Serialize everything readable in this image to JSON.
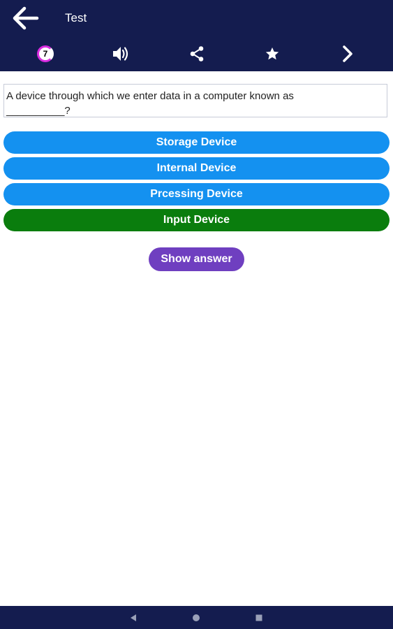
{
  "colors": {
    "appbar": "#141c4f",
    "option_default": "#1491f0",
    "option_correct": "#0a7d0d",
    "show_answer": "#6f3fc0",
    "timer_ring": "#d82ce0"
  },
  "header": {
    "title": "Test",
    "timer_value": "7",
    "icons": [
      "back-arrow-icon",
      "timer-icon",
      "speaker-icon",
      "share-icon",
      "star-icon",
      "chevron-right-icon"
    ]
  },
  "question": {
    "text": "A device through which we enter data in a computer known as",
    "blank": "__________?"
  },
  "options": [
    {
      "label": "Storage Device",
      "state": "default"
    },
    {
      "label": "Internal Device",
      "state": "default"
    },
    {
      "label": "Prcessing Device",
      "state": "default"
    },
    {
      "label": "Input Device",
      "state": "correct"
    }
  ],
  "actions": {
    "show_answer_label": "Show answer"
  },
  "system_nav": {
    "icons": [
      "back-triangle-icon",
      "home-circle-icon",
      "recents-square-icon"
    ]
  }
}
